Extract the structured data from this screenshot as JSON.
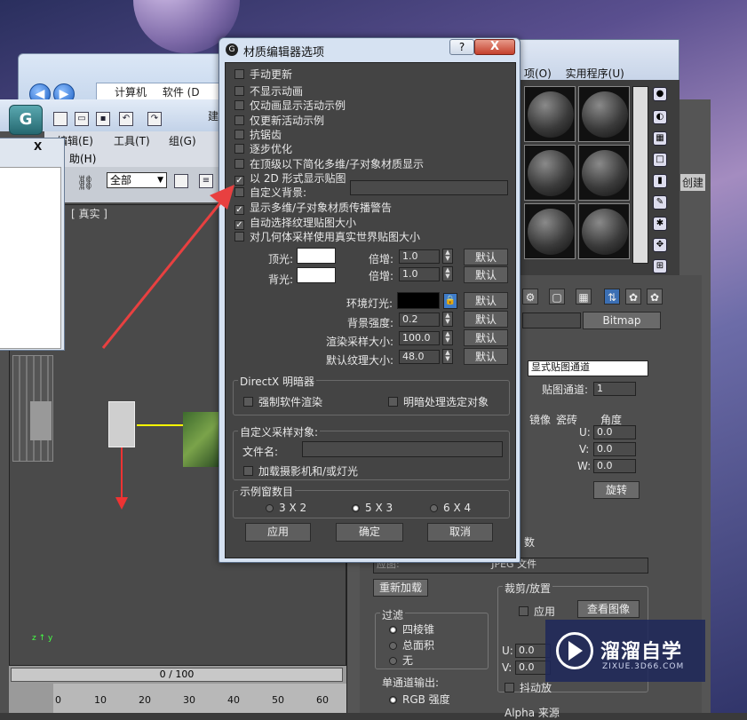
{
  "explorer": {
    "breadcrumb": [
      "计算机",
      "软件 (D"
    ],
    "menu": [
      "项(O)",
      "实用程序(U)"
    ]
  },
  "max_app": {
    "menus": [
      "编辑(E)",
      "工具(T)",
      "组(G)"
    ],
    "menu2": "助(H)",
    "selection_filter": "全部",
    "viewport_label": "[ 真实 ]",
    "time_slider": "0 / 100",
    "ruler_ticks": [
      "0",
      "10",
      "20",
      "30",
      "40",
      "50",
      "60"
    ],
    "title_fragment": "建"
  },
  "material_editor": {
    "menu": [
      "项(O)",
      "实用程序(U)"
    ],
    "map_type": "Bitmap",
    "map_channel_type": "显式贴图通道",
    "map_channel_label": "贴图通道:",
    "map_channel_value": "1",
    "mirror_label": "镜像",
    "tile_label": "瓷砖",
    "angle_label": "角度",
    "u_label": "U:",
    "v_label": "V:",
    "w_label": "W:",
    "u_angle": "0.0",
    "v_angle": "0.0",
    "w_angle": "0.0",
    "rotate_button": "旋转",
    "jpeg_label": "JPEG 文件",
    "reload_button": "重新加载",
    "crop_group": "裁剪/放置",
    "apply_label": "应用",
    "view_image_button": "查看图像",
    "filter_group": "过滤",
    "filter_options": [
      "四棱锥",
      "总面积",
      "无"
    ],
    "mono_output": "单通道输出:",
    "rgb_intensity": "RGB 强度",
    "jitter_label": "抖动放",
    "crop_u": "0.0",
    "crop_v": "0.0",
    "crop_u_label": "U:",
    "crop_v_label": "V:",
    "create_label": "创建",
    "alpha_source": "Alpha 来源",
    "param_label": "数",
    "use_label": "应图:"
  },
  "dialog": {
    "title": "材质编辑器选项",
    "help": "?",
    "close": "X",
    "checkboxes": [
      {
        "label": "手动更新",
        "checked": false
      },
      {
        "label": "不显示动画",
        "checked": false
      },
      {
        "label": "仅动画显示活动示例",
        "checked": false
      },
      {
        "label": "仅更新活动示例",
        "checked": false
      },
      {
        "label": "抗锯齿",
        "checked": false
      },
      {
        "label": "逐步优化",
        "checked": false
      },
      {
        "label": "在顶级以下简化多维/子对象材质显示",
        "checked": false
      },
      {
        "label": "以 2D 形式显示贴图",
        "checked": true
      },
      {
        "label": "自定义背景:",
        "checked": false
      },
      {
        "label": "显示多维/子对象材质传播警告",
        "checked": true
      },
      {
        "label": "自动选择纹理贴图大小",
        "checked": true
      },
      {
        "label": "对几何体采样使用真实世界贴图大小",
        "checked": false
      }
    ],
    "top_light_label": "顶光:",
    "back_light_label": "背光:",
    "multiplier_label": "倍增:",
    "top_multiplier": "1.0",
    "back_multiplier": "1.0",
    "default_button": "默认",
    "ambient_label": "环境灯光:",
    "bg_intensity_label": "背景强度:",
    "bg_intensity": "0.2",
    "render_sample_label": "渲染采样大小:",
    "render_sample": "100.0",
    "default_texture_label": "默认纹理大小:",
    "default_texture": "48.0",
    "directx_group": "DirectX 明暗器",
    "force_software": "强制软件渲染",
    "shade_selected": "明暗处理选定对象",
    "custom_sample_group": "自定义采样对象:",
    "filename_label": "文件名:",
    "load_camera": "加载摄影机和/或灯光",
    "slots_group": "示例窗数目",
    "slots_options": [
      {
        "label": "3 X 2",
        "selected": false
      },
      {
        "label": "5 X 3",
        "selected": true
      },
      {
        "label": "6 X 4",
        "selected": false
      }
    ],
    "apply_button": "应用",
    "ok_button": "确定",
    "cancel_button": "取消"
  },
  "watermark": {
    "title": "溜溜自学",
    "url": "ZIXUE.3D66.COM"
  },
  "colors": {
    "dialog_bg": "#444444",
    "close_red": "#c4402c",
    "arrow": "#e84040"
  }
}
